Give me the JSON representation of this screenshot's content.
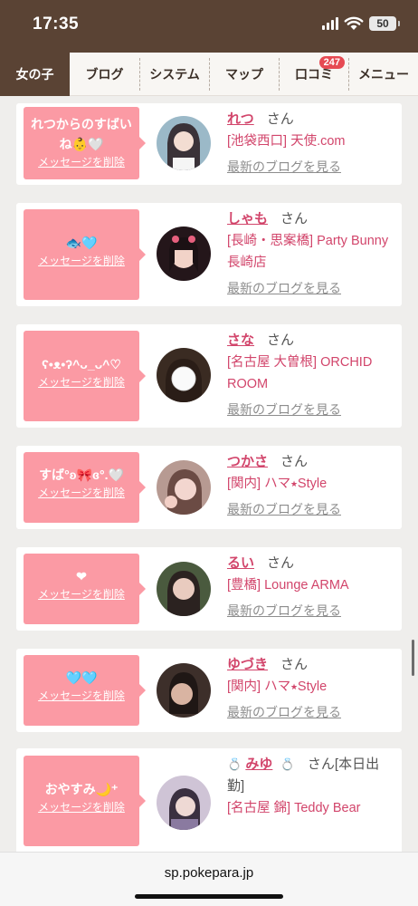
{
  "status_bar": {
    "time": "17:35",
    "battery": "50"
  },
  "nav": {
    "tabs": [
      {
        "label": "女の子"
      },
      {
        "label": "ブログ"
      },
      {
        "label": "システム"
      },
      {
        "label": "マップ"
      },
      {
        "label": "口コミ",
        "badge": "247"
      },
      {
        "label": "メニュー"
      }
    ]
  },
  "delete_label": "メッセージを削除",
  "blog_label": "最新のブログを見る",
  "honorific": "さん",
  "cards": [
    {
      "message": "れつからのすばいね👶🤍",
      "name": "れつ",
      "shop": "[池袋西口] 天使.com"
    },
    {
      "message": "🐟🩵",
      "name": "しゃも",
      "shop": "[長崎・思案橋] Party Bunny 長崎店"
    },
    {
      "message": "ʕ•ᴥ•ʔ^ᴗ_ᴗ^♡",
      "name": "さな",
      "shop": "[名古屋 大曽根] ORCHID ROOM"
    },
    {
      "message": "すば°ʚ🎀ɞ°.🤍",
      "name": "つかさ",
      "shop": "[関内] ハマ⭑Style"
    },
    {
      "message": "❤︎",
      "name": "るい",
      "shop": "[豊橋] Lounge ARMA"
    },
    {
      "message": "🩵🩵",
      "name": "ゆづき",
      "shop": "[関内] ハマ⭑Style"
    },
    {
      "message": "おやすみ🌙⁺",
      "name": "みゆ",
      "name_suffix": "さん[本日出勤]",
      "shop": "[名古屋 錦] Teddy Bear"
    }
  ],
  "bottom": {
    "url": "sp.pokepara.jp"
  }
}
